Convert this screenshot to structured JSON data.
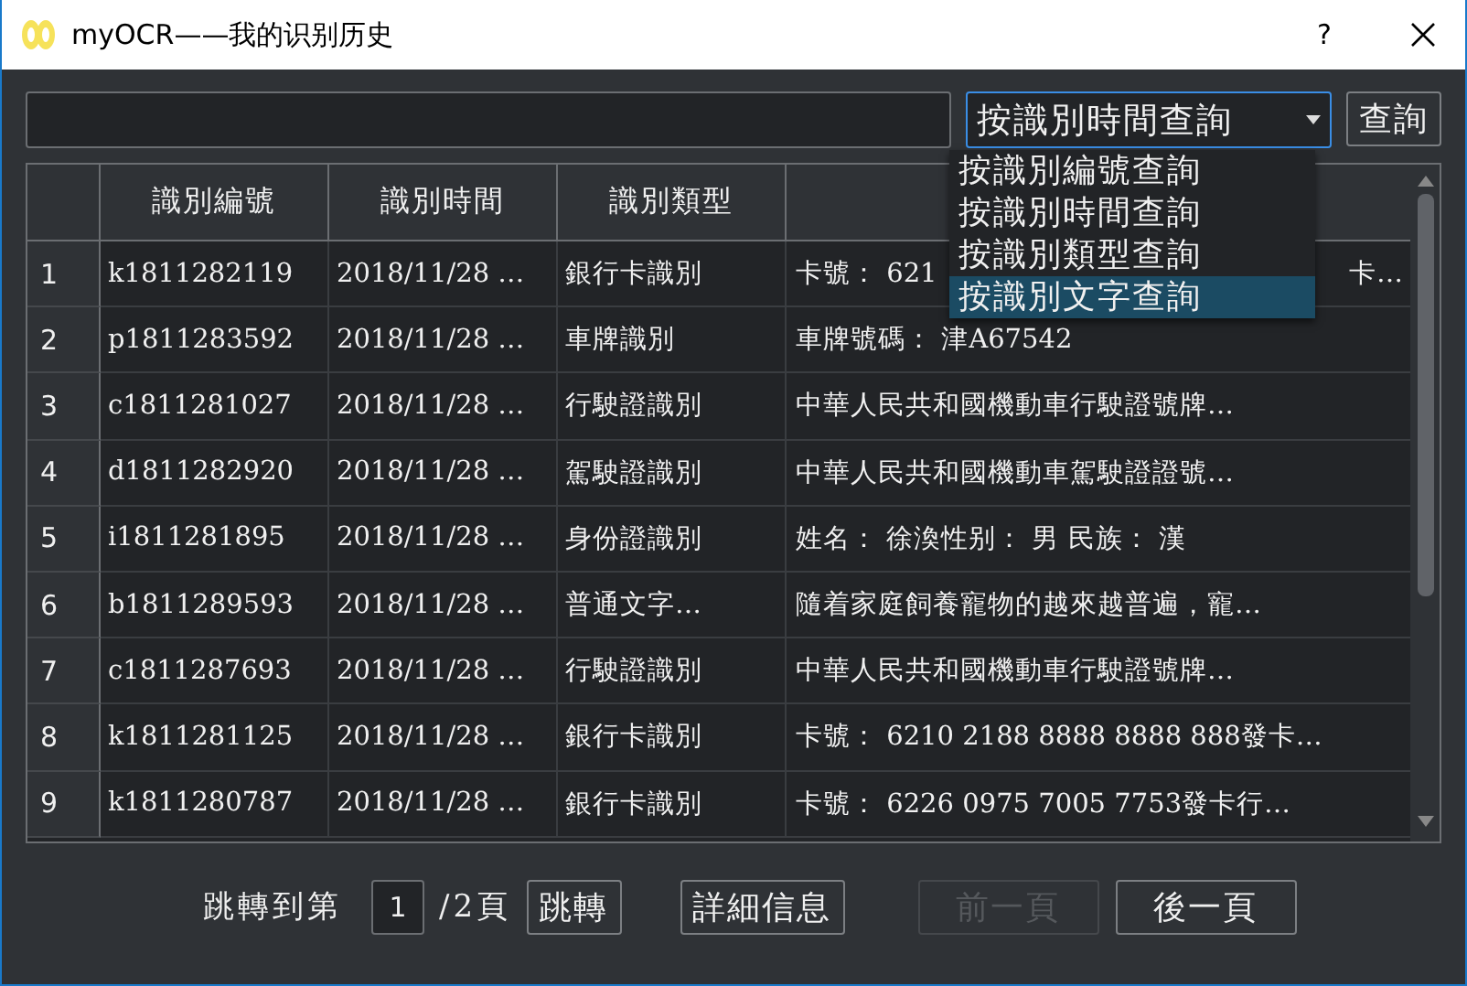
{
  "window": {
    "title": "myOCR——我的识别历史",
    "help": "?"
  },
  "search": {
    "combo": "按識別時間查詢",
    "button": "查詢"
  },
  "dropdown": [
    {
      "label": "按識別編號查詢",
      "selected": false
    },
    {
      "label": "按識別時間查詢",
      "selected": false
    },
    {
      "label": "按識別類型查詢",
      "selected": false
    },
    {
      "label": "按識別文字查詢",
      "selected": true
    }
  ],
  "table": {
    "columns": [
      "識別編號",
      "識別時間",
      "識別類型"
    ],
    "rows": [
      {
        "index": "1",
        "id": "k1811282119",
        "time": "2018/11/28 …",
        "type": "銀行卡識別",
        "text": "卡號： 621",
        "tail": "卡…"
      },
      {
        "index": "2",
        "id": "p1811283592",
        "time": "2018/11/28 …",
        "type": "車牌識別",
        "text": "車牌號碼： 津A67542"
      },
      {
        "index": "3",
        "id": "c1811281027",
        "time": "2018/11/28 …",
        "type": "行駛證識別",
        "text": "中華人民共和國機動車行駛證號牌…"
      },
      {
        "index": "4",
        "id": "d1811282920",
        "time": "2018/11/28 …",
        "type": "駕駛證識別",
        "text": "中華人民共和國機動車駕駛證證號…"
      },
      {
        "index": "5",
        "id": "i1811281895",
        "time": "2018/11/28 …",
        "type": "身份證識別",
        "text": "姓名： 徐渙性别： 男   民族： 漢"
      },
      {
        "index": "6",
        "id": "b1811289593",
        "time": "2018/11/28 …",
        "type": "普通文字…",
        "text": "隨着家庭飼養寵物的越來越普遍，寵…"
      },
      {
        "index": "7",
        "id": "c1811287693",
        "time": "2018/11/28 …",
        "type": "行駛證識別",
        "text": "中華人民共和國機動車行駛證號牌…"
      },
      {
        "index": "8",
        "id": "k1811281125",
        "time": "2018/11/28 …",
        "type": "銀行卡識別",
        "text": "卡號： 6210 2188 8888 8888 888發卡…"
      },
      {
        "index": "9",
        "id": "k1811280787",
        "time": "2018/11/28 …",
        "type": "銀行卡識別",
        "text": "卡號： 6226 0975 7005 7753發卡行…"
      }
    ]
  },
  "pager": {
    "jump_label": "跳轉到第",
    "page": "1",
    "total": "/2頁",
    "jump_button": "跳轉",
    "detail_button": "詳細信息",
    "prev": {
      "label": "前一頁",
      "disabled": true
    },
    "next": {
      "label": "後一頁",
      "disabled": false
    }
  }
}
